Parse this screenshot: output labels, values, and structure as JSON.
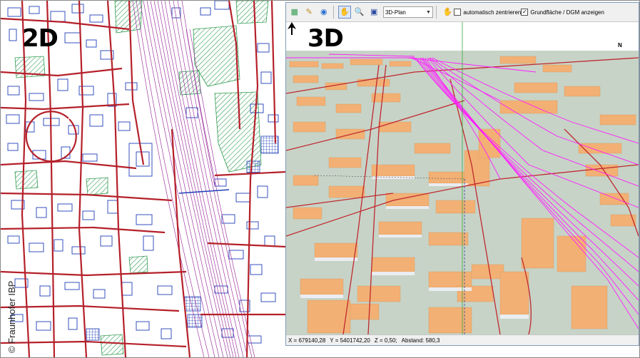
{
  "labels": {
    "left_view": "2D",
    "right_view": "3D",
    "copyright": "© Fraunhofer IBP"
  },
  "toolbar": {
    "view_mode": "3D-Plan",
    "auto_center_label": "automatisch zentrieren",
    "auto_center_checked": false,
    "ground_dgm_label": "Grundfläche / DGM anzeigen",
    "ground_dgm_checked": true,
    "icons": [
      "layer-color-icon",
      "layer-edit-icon",
      "globe-icon",
      "select-pointer-icon",
      "zoom-icon",
      "zoom-window-icon",
      "pan-hand-icon"
    ]
  },
  "status": {
    "x": "X = 679140,28",
    "y": "Y = 5401742,20",
    "z": "Z = 0,50;",
    "distance": "Abstand: 580,3"
  },
  "north_label": "N",
  "colors": {
    "road": "#b5202a",
    "building_outline": "#1f3fb8",
    "hatch": "#2e9a4e",
    "rail": "#a03aa0",
    "rail_3d": "#ff1cff",
    "building_3d": "#f2b074",
    "ground_3d": "#c7d3c7"
  }
}
